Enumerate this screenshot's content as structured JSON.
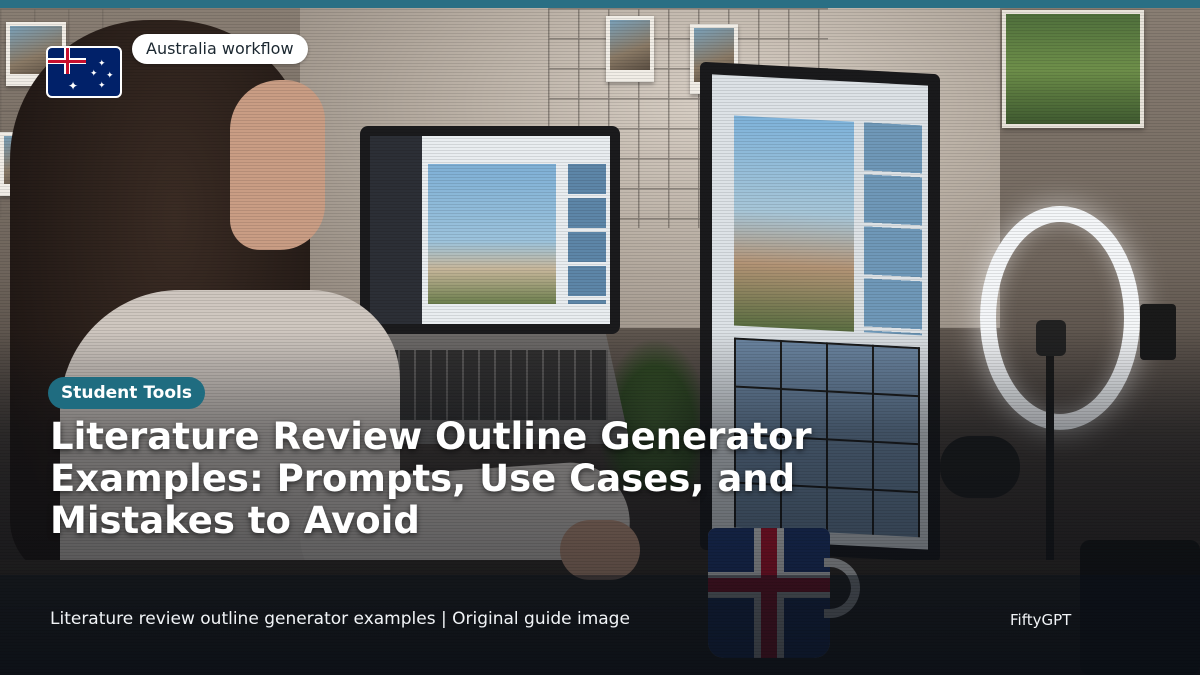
{
  "header": {
    "region_chip": "Australia workflow",
    "flag_icon": "australia-flag-icon"
  },
  "article": {
    "category": "Student Tools",
    "title": "Literature Review Outline Generator Examples: Prompts, Use Cases, and Mistakes to Avoid"
  },
  "footer": {
    "caption": "Literature review outline generator examples | Original guide image",
    "brand": "FiftyGPT"
  },
  "colors": {
    "accent_bar": "#2a6f84",
    "category_chip": "#1f6c80",
    "chip_background": "#ffffff",
    "headline_text": "#ffffff"
  }
}
